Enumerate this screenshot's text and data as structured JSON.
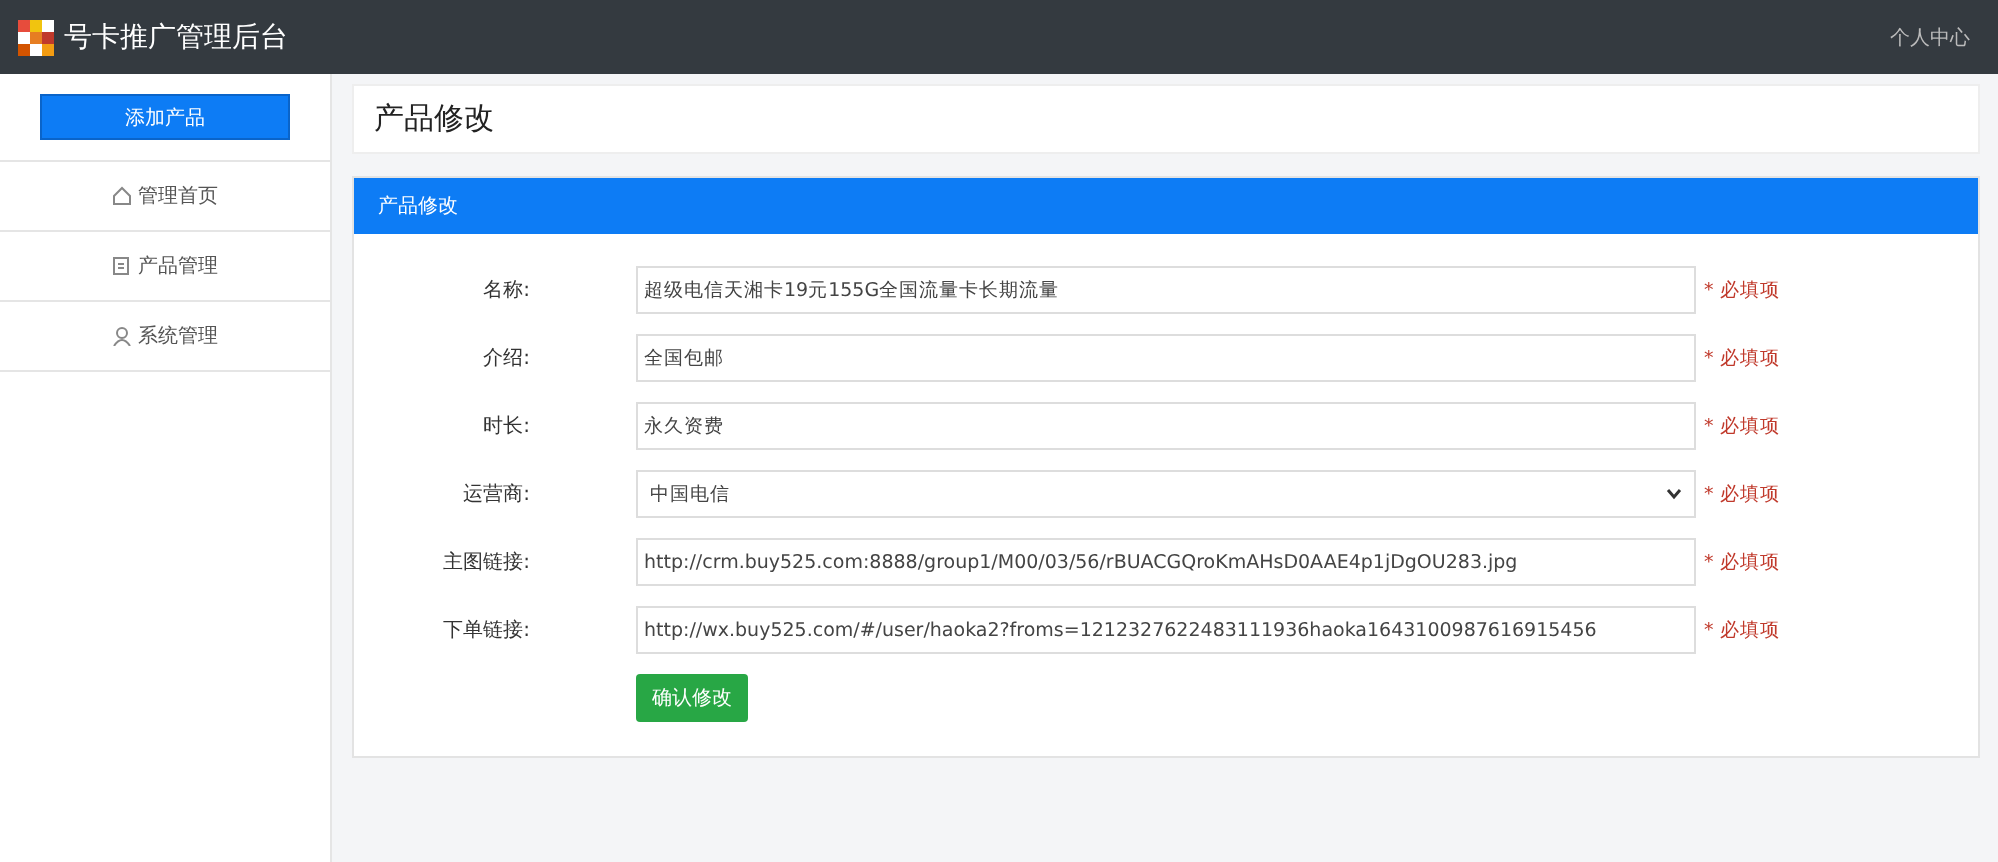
{
  "header": {
    "title": "号卡推广管理后台",
    "user_menu": "个人中心"
  },
  "sidebar": {
    "add_button": "添加产品",
    "items": [
      {
        "label": "管理首页",
        "kind": "home",
        "selected": false
      },
      {
        "label": "产品管理",
        "kind": "doc",
        "selected": false
      },
      {
        "label": "系统管理",
        "kind": "user",
        "selected": false
      }
    ]
  },
  "page_title": "产品修改",
  "panel": {
    "title": "产品修改",
    "fields": [
      {
        "kind": "input",
        "label": "名称:",
        "value": "超级电信天湘卡19元155G全国流量卡长期流量",
        "note": "* 必填项"
      },
      {
        "kind": "input",
        "label": "介绍:",
        "value": "全国包邮",
        "note": "* 必填项"
      },
      {
        "kind": "input",
        "label": "时长:",
        "value": "永久资费",
        "note": "* 必填项"
      },
      {
        "kind": "select",
        "label": "运营商:",
        "value": "中国电信",
        "note": "* 必填项"
      },
      {
        "kind": "input",
        "label": "主图链接:",
        "value": "http://crm.buy525.com:8888/group1/M00/03/56/rBUACGQroKmAHsD0AAE4p1jDgOU283.jpg",
        "note": "* 必填项"
      },
      {
        "kind": "input",
        "label": "下单链接:",
        "value": "http://wx.buy525.com/#/user/haoka2?froms=1212327622483111936haoka1643100987616915456",
        "note": "* 必填项"
      }
    ],
    "submit": "确认修改"
  }
}
